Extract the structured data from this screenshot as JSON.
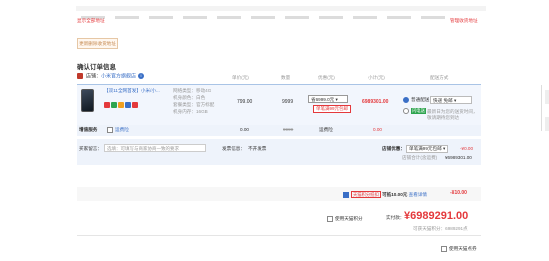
{
  "top_links": {
    "left": "显示全部地址",
    "right": "管理收货地址"
  },
  "edit_button_label": "更新删除收货地址",
  "section_title": "确认订单信息",
  "columns": {
    "price": "单价(元)",
    "qty": "数量",
    "promo": "优惠(元)",
    "subtotal": "小计(元)",
    "shipping": "配送方式"
  },
  "shop": {
    "label": "店铺：",
    "name": "小米官方旗舰店",
    "info_icon": "i"
  },
  "product": {
    "title": "【双11全网首发】小米/小...",
    "attrs": [
      "网络类型：移动4G",
      "机身颜色：白色",
      "套餐类型：官方标配",
      "机身内存：16GB"
    ],
    "price": "799.00",
    "qty": "9999",
    "promo_select": "省6999.0元",
    "promo_tag": "单笔满99元包邮",
    "subtotal": "6989301.00",
    "shipping_label": "普通配送",
    "shipping_select": "快递 免邮",
    "shipping_option2_tag": "闪电送",
    "shipping_option2_text": "最新日为您的送货时间，敬请期待您到达",
    "badge_colors": [
      "#e4393c",
      "#2ea44f",
      "#f0a020",
      "#3a6fc6",
      "#e4393c"
    ]
  },
  "service": {
    "label": "增值服务",
    "option": "运费险",
    "price": "0.00",
    "qty": "9999",
    "promo": "运费险",
    "subtotal": "0.00"
  },
  "message": {
    "label": "买家留言：",
    "placeholder": "选填：可填写与商家协商一致的要求",
    "invoice_label": "发票信息：",
    "invoice_value": "不开发票",
    "shop_discount_label": "店铺优惠：",
    "shop_discount_select": "单笔满99元包邮",
    "shop_discount_value": "-¥0.00",
    "shop_total_label": "店铺合计(含运费)",
    "shop_total_value": "¥6989301.00"
  },
  "coupon": {
    "tag": "天猫积分抵扣",
    "text": "可抵10.00元",
    "link": "查看详情",
    "value": "-¥10.00"
  },
  "points": {
    "label": "使用天猫积分"
  },
  "total": {
    "label": "实付款：",
    "value": "¥6989291.00",
    "sub_label": "可获天猫积分：",
    "sub_value": "6989291点"
  },
  "anonymous": {
    "label": "匿名购买"
  },
  "bottom": {
    "label": "使用天猫点券"
  },
  "colors": {
    "accent_red": "#e4393c",
    "link_blue": "#3a6fc6",
    "row_bg": "#eef3fb"
  }
}
